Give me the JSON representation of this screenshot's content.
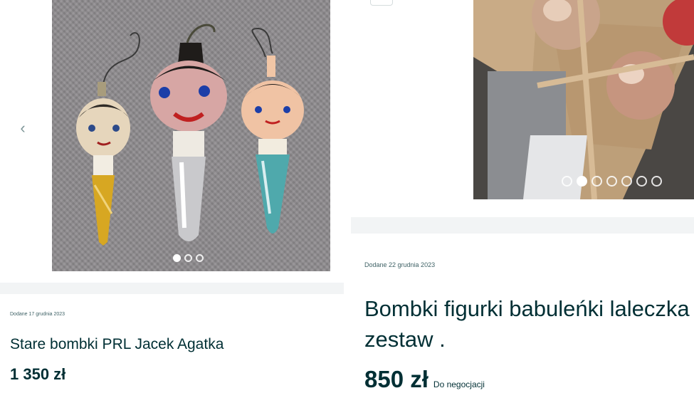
{
  "left_listing": {
    "added_date": "Dodane 17 grudnia 2023",
    "title": "Stare bombki PRL Jacek Agatka",
    "price": "1 350 zł",
    "gallery": {
      "photo_count": 3,
      "active_index": 0,
      "prev_arrow": "‹"
    }
  },
  "right_listing": {
    "added_date": "Dodane 22 grudnia 2023",
    "title": "Bombki figurki babuleńki laleczka zestaw .",
    "price": "850 zł",
    "price_note": "Do negocjacji",
    "gallery": {
      "photo_count": 7,
      "active_index": 1
    }
  }
}
